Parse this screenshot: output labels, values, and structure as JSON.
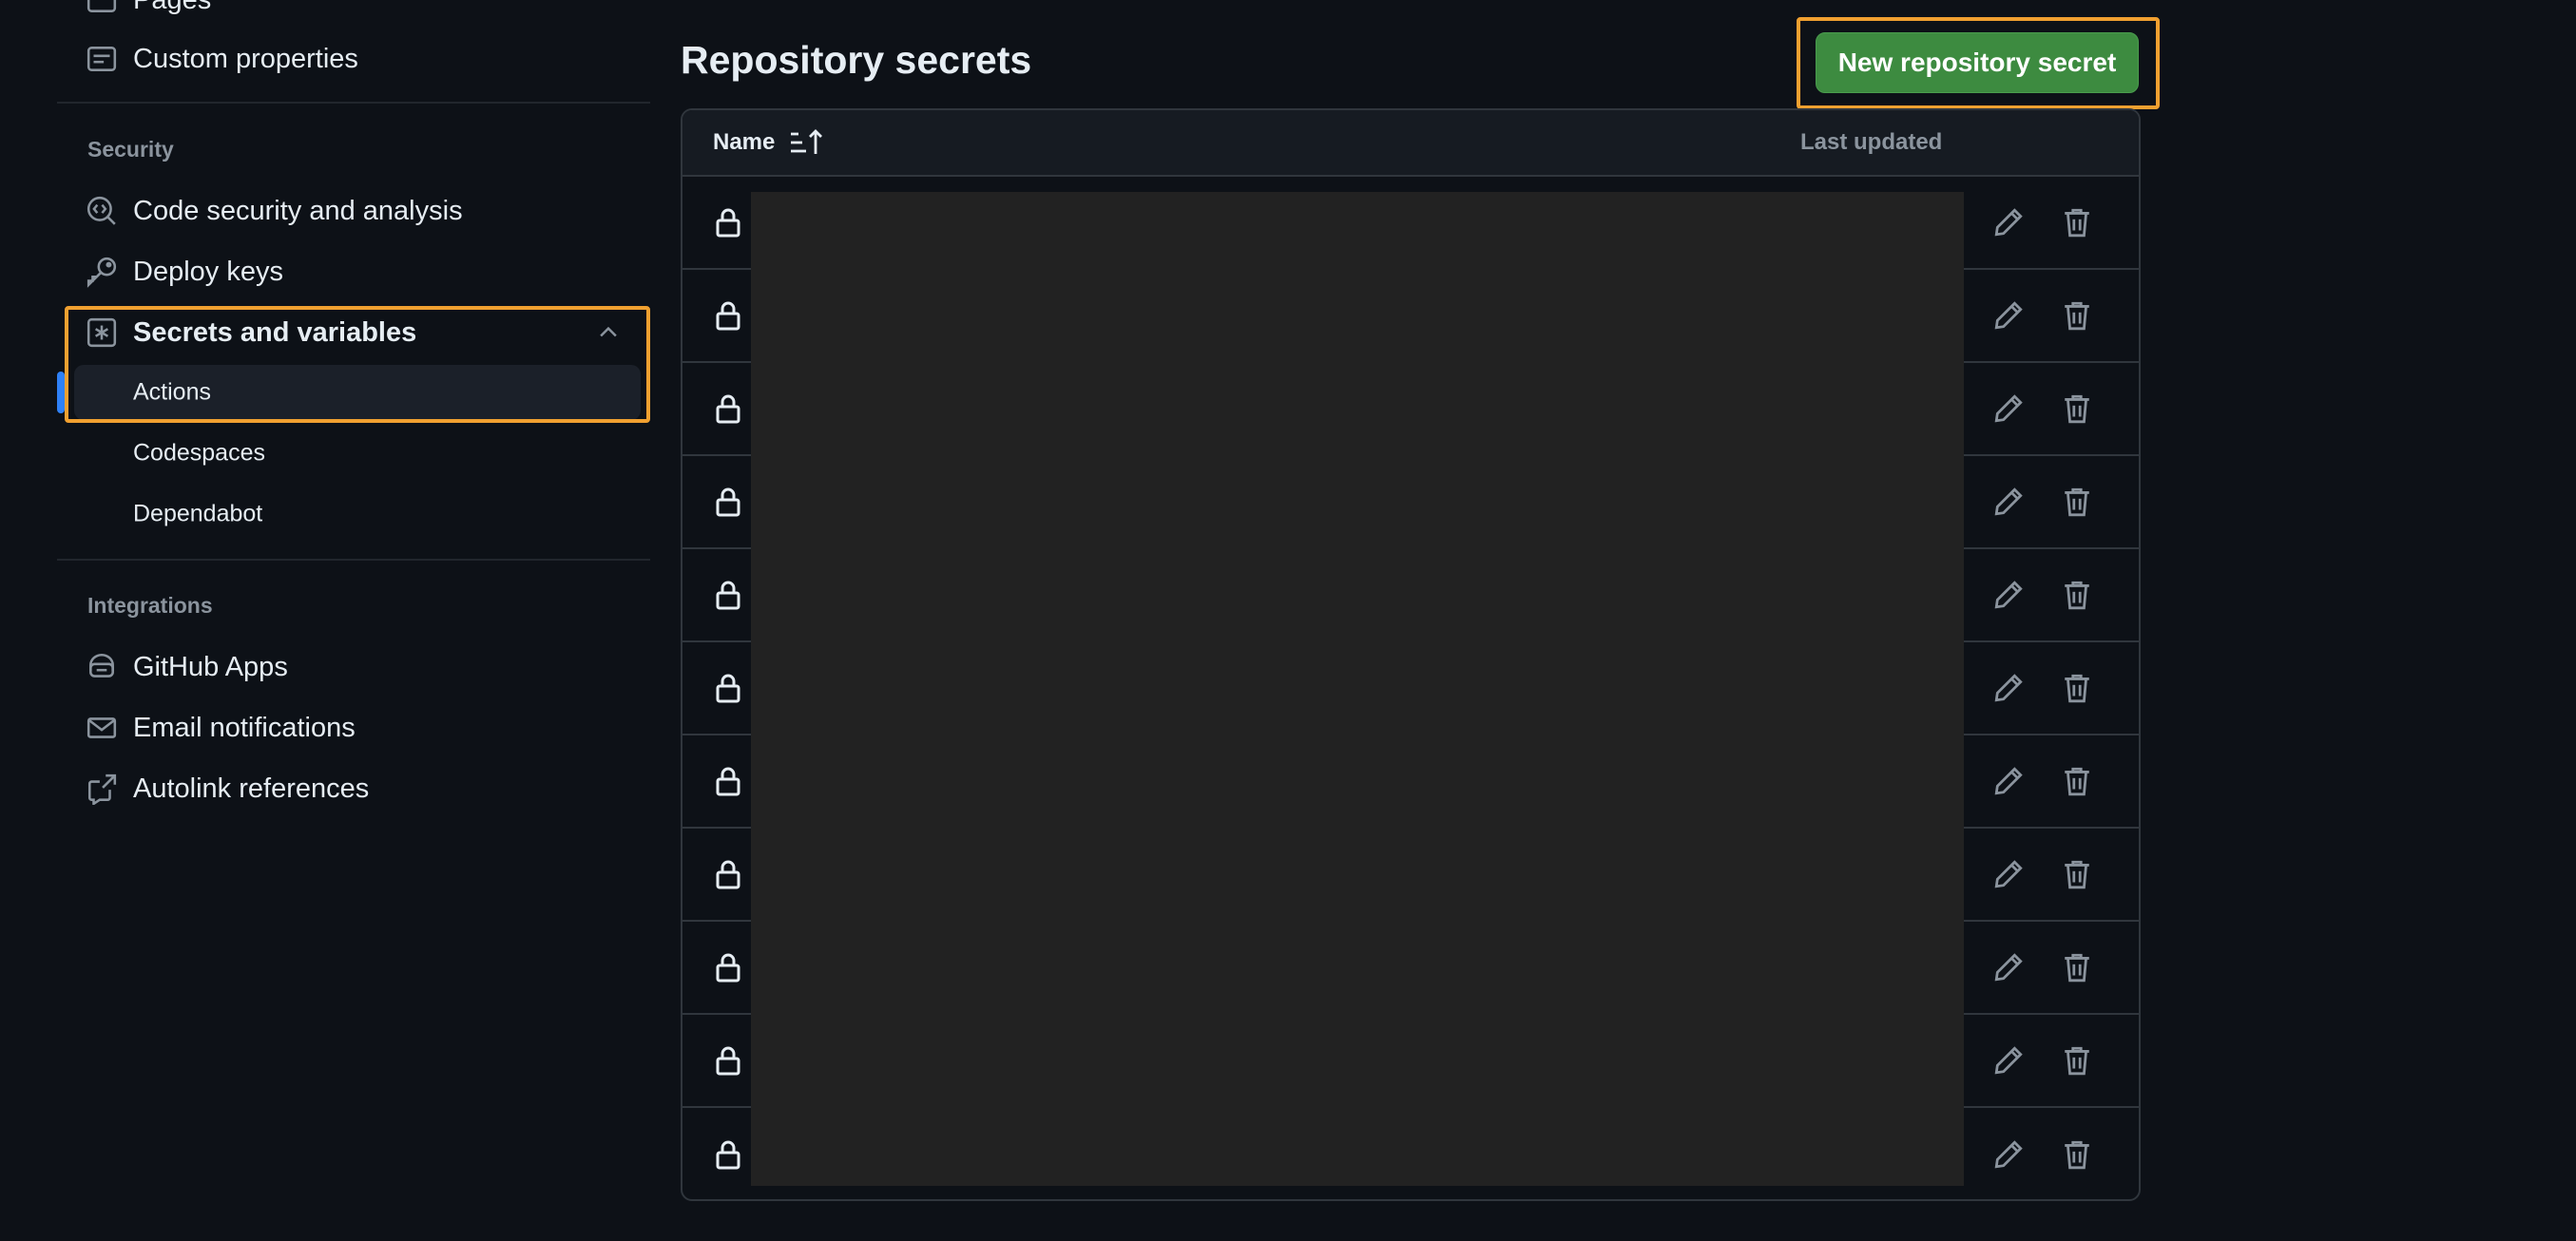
{
  "sidebar": {
    "top_items": [
      {
        "label": "Pages",
        "icon": "browser-icon"
      },
      {
        "label": "Custom properties",
        "icon": "note-icon"
      }
    ],
    "security": {
      "header": "Security",
      "items": [
        {
          "label": "Code security and analysis",
          "icon": "codescan-icon"
        },
        {
          "label": "Deploy keys",
          "icon": "key-icon"
        }
      ],
      "secrets": {
        "label": "Secrets and variables",
        "icon": "asterisk-icon",
        "expanded": true,
        "children": [
          {
            "label": "Actions",
            "active": true
          },
          {
            "label": "Codespaces",
            "active": false
          },
          {
            "label": "Dependabot",
            "active": false
          }
        ]
      }
    },
    "integrations": {
      "header": "Integrations",
      "items": [
        {
          "label": "GitHub Apps",
          "icon": "hubot-icon"
        },
        {
          "label": "Email notifications",
          "icon": "mail-icon"
        },
        {
          "label": "Autolink references",
          "icon": "cross-reference-icon"
        }
      ]
    }
  },
  "main": {
    "title": "Repository secrets",
    "new_button": "New repository secret",
    "table": {
      "col_name": "Name",
      "col_updated": "Last updated",
      "row_count": 11
    }
  },
  "colors": {
    "background": "#0d1117",
    "button_green": "#3d8b40",
    "highlight_orange": "#f0a030",
    "active_indicator": "#2f81f7"
  }
}
